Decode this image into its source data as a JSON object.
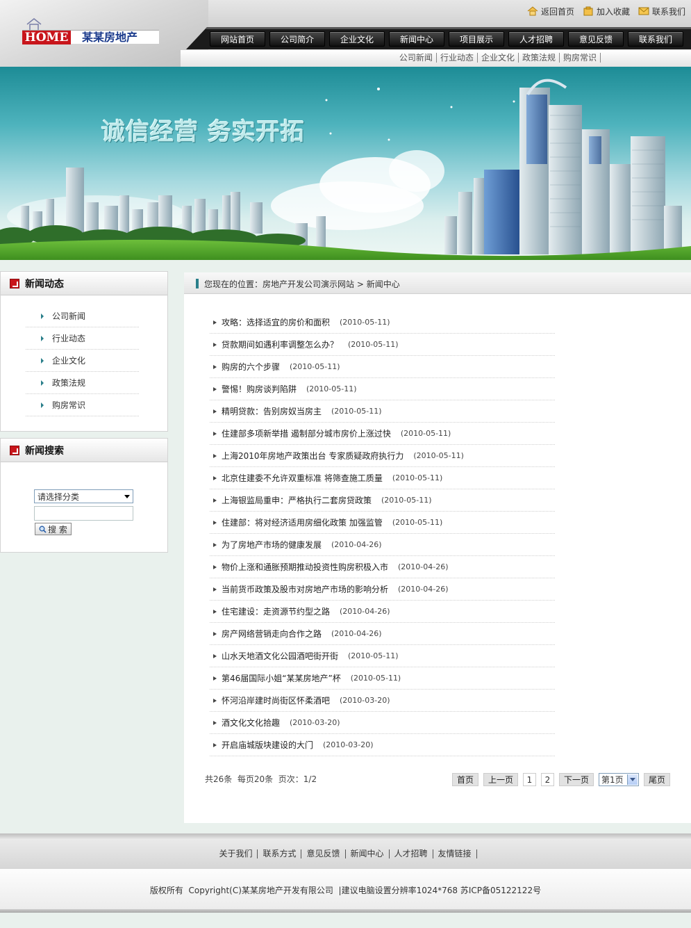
{
  "logo": {
    "home_text": "HOME",
    "company_name": "某某房地产"
  },
  "topbar": [
    {
      "label": "返回首页",
      "icon": "home-icon"
    },
    {
      "label": "加入收藏",
      "icon": "favorite-icon"
    },
    {
      "label": "联系我们",
      "icon": "mail-icon"
    }
  ],
  "nav": [
    "网站首页",
    "公司简介",
    "企业文化",
    "新闻中心",
    "项目展示",
    "人才招聘",
    "意见反馈",
    "联系我们"
  ],
  "subnav": [
    "公司新闻",
    "行业动态",
    "企业文化",
    "政策法规",
    "购房常识"
  ],
  "banner": {
    "slogan": "诚信经营 务实开拓"
  },
  "sidebar": {
    "news_title": "新闻动态",
    "news_items": [
      "公司新闻",
      "行业动态",
      "企业文化",
      "政策法规",
      "购房常识"
    ],
    "search_title": "新闻搜索",
    "category_selected": "请选择分类",
    "keyword_value": "",
    "search_button": "搜 索"
  },
  "breadcrumb": {
    "prefix": "您现在的位置：",
    "site": "房地产开发公司演示网站",
    "separator": " > ",
    "current": "新闻中心"
  },
  "news": [
    {
      "title": "攻略：选择适宜的房价和面积",
      "date": "(2010-05-11)"
    },
    {
      "title": "贷款期间如遇利率调整怎么办？",
      "date": "(2010-05-11)"
    },
    {
      "title": "购房的六个步骤",
      "date": "(2010-05-11)"
    },
    {
      "title": "警惕！购房谈判陷阱",
      "date": "(2010-05-11)"
    },
    {
      "title": "精明贷款：告别房奴当房主",
      "date": "(2010-05-11)"
    },
    {
      "title": "住建部多项新举措 遏制部分城市房价上涨过快",
      "date": "(2010-05-11)"
    },
    {
      "title": "上海2010年房地产政策出台 专家质疑政府执行力",
      "date": "(2010-05-11)"
    },
    {
      "title": "北京住建委不允许双重标准 将筛查施工质量",
      "date": "(2010-05-11)"
    },
    {
      "title": "上海银监局重申：严格执行二套房贷政策",
      "date": "(2010-05-11)"
    },
    {
      "title": "住建部：将对经济适用房细化政策 加强监管",
      "date": "(2010-05-11)"
    },
    {
      "title": "为了房地产市场的健康发展",
      "date": "(2010-04-26)"
    },
    {
      "title": "物价上涨和通胀预期推动投资性购房积极入市",
      "date": "(2010-04-26)"
    },
    {
      "title": "当前货币政策及股市对房地产市场的影响分析",
      "date": "(2010-04-26)"
    },
    {
      "title": "住宅建设：走资源节约型之路",
      "date": "(2010-04-26)"
    },
    {
      "title": "房产网络营销走向合作之路",
      "date": "(2010-04-26)"
    },
    {
      "title": "山水天地酒文化公园酒吧街开街",
      "date": "(2010-05-11)"
    },
    {
      "title": "第46届国际小姐“某某房地产”杯",
      "date": "(2010-05-11)"
    },
    {
      "title": "怀河沿岸建时尚街区怀柔酒吧",
      "date": "(2010-03-20)"
    },
    {
      "title": "酒文化文化拾趣",
      "date": "(2010-03-20)"
    },
    {
      "title": "开启庙城版块建设的大门",
      "date": "(2010-03-20)"
    }
  ],
  "pager": {
    "info": "共26条  每页20条  页次：1/2",
    "first": "首页",
    "prev": "上一页",
    "pages": [
      "1",
      "2"
    ],
    "next": "下一页",
    "select_value": "第1页",
    "last": "尾页"
  },
  "footer": {
    "links": [
      "关于我们",
      "联系方式",
      "意见反馈",
      "新闻中心",
      "人才招聘",
      "友情链接"
    ],
    "copyright": "版权所有  Copyright(C)某某房地产开发有限公司  |建议电脑设置分辨率1024*768 苏ICP备05122122号"
  }
}
